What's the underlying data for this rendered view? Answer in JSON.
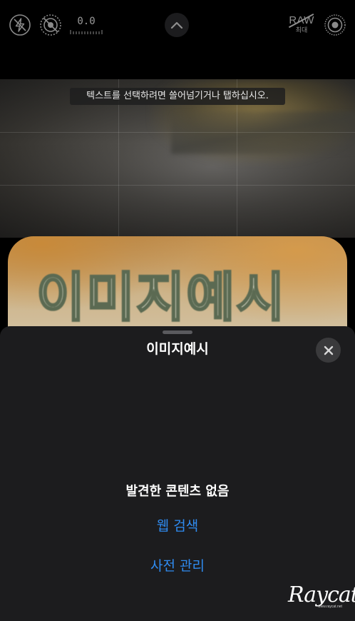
{
  "camera_toolbar": {
    "flash_icon": "flash-off-icon",
    "live_photo_icon": "live-photo-off-icon",
    "exposure_value": "0.0",
    "chevron_icon": "chevron-up-icon",
    "raw_label": "RAW",
    "raw_sub_label": "최대",
    "settings_icon": "live-settings-icon"
  },
  "viewfinder": {
    "hint_text": "텍스트를 선택하려면 쓸어넘기거나 탭하십시오."
  },
  "preview": {
    "captured_text": "이미지예시"
  },
  "lookup_sheet": {
    "title": "이미지예시",
    "close_icon": "close-icon",
    "empty_message": "발견한 콘텐츠 없음",
    "web_search_label": "웹 검색",
    "manage_dictionary_label": "사전 관리"
  },
  "watermark": {
    "brand": "Raycat",
    "url": "www.raycat.net"
  },
  "colors": {
    "accent": "#2f8bf0",
    "sheet_background": "#1c1c1e",
    "close_button_background": "#3a3a3c"
  }
}
